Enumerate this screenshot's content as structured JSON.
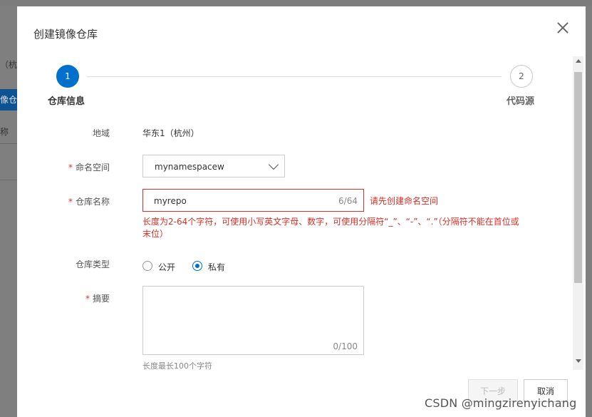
{
  "background": {
    "text1": "（杭州",
    "tab_label": "像仓库",
    "text2": "称"
  },
  "modal": {
    "title": "创建镜像仓库",
    "steps": [
      {
        "number": "1",
        "label": "仓库信息",
        "active": true
      },
      {
        "number": "2",
        "label": "代码源",
        "active": false
      }
    ],
    "form": {
      "region_label": "地域",
      "region_value": "华东1（杭州）",
      "namespace_label": "命名空间",
      "namespace_value": "mynamespacew",
      "repo_name_label": "仓库名称",
      "repo_name_value": "myrepo",
      "repo_name_count": "6/64",
      "repo_name_error": "请先创建命名空间",
      "repo_name_hint": "长度为2-64个字符，可使用小写英文字母、数字，可使用分隔符“_”、“-”、“.”（分隔符不能在首位或末位）",
      "repo_type_label": "仓库类型",
      "repo_type_options": [
        {
          "label": "公开",
          "selected": false
        },
        {
          "label": "私有",
          "selected": true
        }
      ],
      "summary_label": "摘要",
      "summary_value": "",
      "summary_count": "0/100",
      "summary_hint": "长度最长100个字符"
    },
    "buttons": {
      "next": "下一步",
      "cancel": "取消"
    }
  },
  "watermark": "CSDN @mingzirenyichang",
  "colors": {
    "accent": "#0070cc",
    "error": "#d93026",
    "overlay": "#7f7f7f"
  }
}
